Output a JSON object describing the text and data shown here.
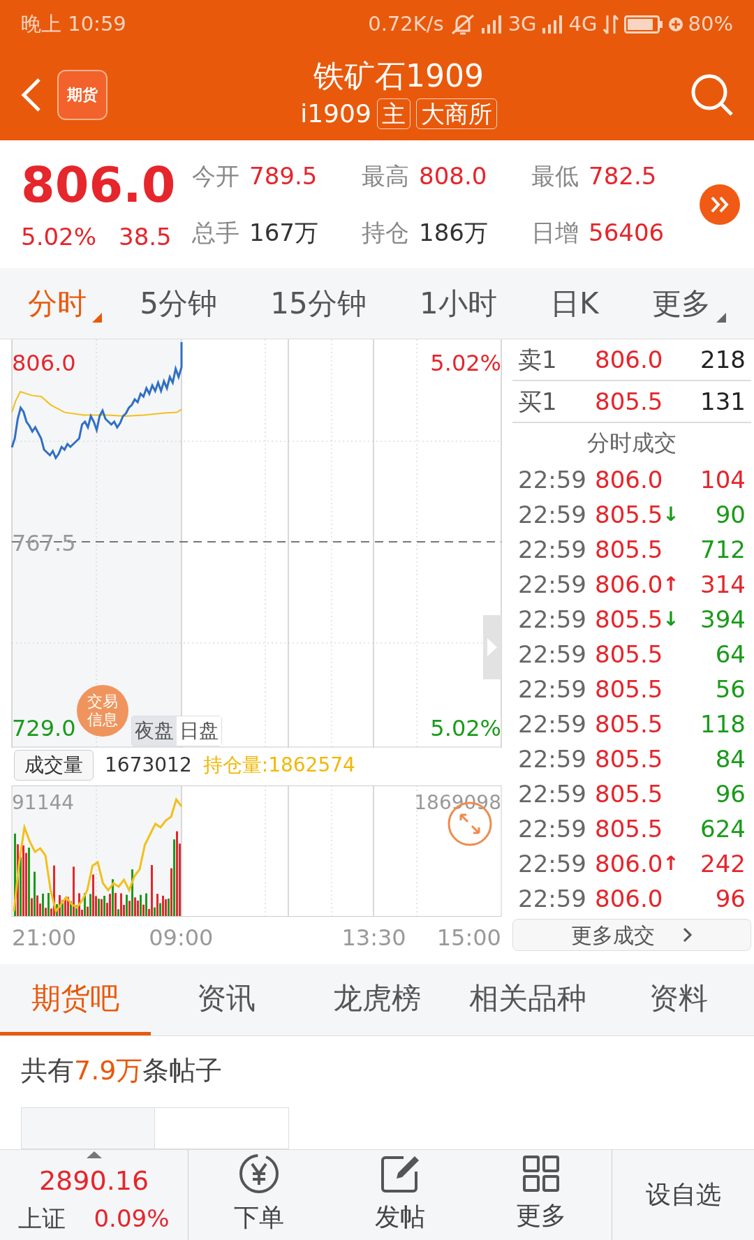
{
  "status_bar": {
    "time": "晚上 10:59",
    "speed": "0.72K/s",
    "network_1": "3G",
    "network_2": "4G",
    "battery": "80%"
  },
  "header": {
    "logo_text": "期货",
    "title": "铁矿石1909",
    "code": "i1909",
    "badges": [
      "主",
      "大商所"
    ]
  },
  "quote": {
    "price": "806.0",
    "change_pct": "5.02%",
    "change": "38.5",
    "stats": [
      {
        "label": "今开",
        "value": "789.5",
        "kind": "up"
      },
      {
        "label": "最高",
        "value": "808.0",
        "kind": "up"
      },
      {
        "label": "最低",
        "value": "782.5",
        "kind": "up"
      },
      {
        "label": "总手",
        "value": "167万",
        "kind": "flat"
      },
      {
        "label": "持仓",
        "value": "186万",
        "kind": "flat"
      },
      {
        "label": "日增",
        "value": "56406",
        "kind": "up"
      }
    ]
  },
  "period_tabs": [
    {
      "label": "分时",
      "selected": true,
      "dropdown": true
    },
    {
      "label": "5分钟",
      "selected": false,
      "dropdown": false
    },
    {
      "label": "15分钟",
      "selected": false,
      "dropdown": false
    },
    {
      "label": "1小时",
      "selected": false,
      "dropdown": false
    },
    {
      "label": "日K",
      "selected": false,
      "dropdown": false
    },
    {
      "label": "更多",
      "selected": false,
      "dropdown": true
    }
  ],
  "price_chart": {
    "high": "806.0",
    "high_pct": "5.02%",
    "mid": "767.5",
    "low": "729.0",
    "low_pct": "5.02%",
    "badge": "交易信息",
    "sessions": [
      {
        "label": "夜盘",
        "selected": true
      },
      {
        "label": "日盘",
        "selected": false
      }
    ]
  },
  "volume": {
    "button": "成交量",
    "volume": "1673012",
    "open_interest": "持仓量:1862574",
    "max_volume": "91144",
    "max_oi": "1869098"
  },
  "time_axis": [
    "21:00",
    "09:00",
    "13:30",
    "15:00"
  ],
  "order_book": [
    {
      "label": "卖1",
      "price": "806.0",
      "qty": "218"
    },
    {
      "label": "买1",
      "price": "805.5",
      "qty": "131"
    }
  ],
  "trades_title": "分时成交",
  "trades": [
    {
      "time": "22:59",
      "price": "806.0",
      "qty": "104",
      "color": "#e5262c"
    },
    {
      "time": "22:59",
      "price": "805.5",
      "arrow": "↓",
      "qty": "90",
      "color": "#1a9b1a"
    },
    {
      "time": "22:59",
      "price": "805.5",
      "qty": "712",
      "color": "#1a9b1a"
    },
    {
      "time": "22:59",
      "price": "806.0",
      "arrow": "↑",
      "qty": "314",
      "color": "#e5262c"
    },
    {
      "time": "22:59",
      "price": "805.5",
      "arrow": "↓",
      "qty": "394",
      "color": "#1a9b1a"
    },
    {
      "time": "22:59",
      "price": "805.5",
      "qty": "64",
      "color": "#1a9b1a"
    },
    {
      "time": "22:59",
      "price": "805.5",
      "qty": "56",
      "color": "#1a9b1a"
    },
    {
      "time": "22:59",
      "price": "805.5",
      "qty": "118",
      "color": "#1a9b1a"
    },
    {
      "time": "22:59",
      "price": "805.5",
      "qty": "84",
      "color": "#1a9b1a"
    },
    {
      "time": "22:59",
      "price": "805.5",
      "qty": "96",
      "color": "#1a9b1a"
    },
    {
      "time": "22:59",
      "price": "805.5",
      "qty": "624",
      "color": "#1a9b1a"
    },
    {
      "time": "22:59",
      "price": "806.0",
      "arrow": "↑",
      "qty": "242",
      "color": "#e5262c"
    },
    {
      "time": "22:59",
      "price": "806.0",
      "qty": "96",
      "color": "#e5262c"
    }
  ],
  "more_trades": "更多成交",
  "content_tabs": [
    {
      "label": "期货吧",
      "selected": true
    },
    {
      "label": "资讯",
      "selected": false
    },
    {
      "label": "龙虎榜",
      "selected": false
    },
    {
      "label": "相关品种",
      "selected": false
    },
    {
      "label": "资料",
      "selected": false
    }
  ],
  "post_count": {
    "prefix": "共有",
    "count": "7.9万",
    "suffix": "条帖子"
  },
  "bottom_bar": {
    "index_value": "2890.16",
    "index_name": "上证",
    "index_pct": "0.09%",
    "actions": [
      {
        "label": "下单",
        "kind": "order"
      },
      {
        "label": "发帖",
        "kind": "post"
      },
      {
        "label": "更多",
        "kind": "more"
      }
    ],
    "watchlist": "设自选"
  }
}
